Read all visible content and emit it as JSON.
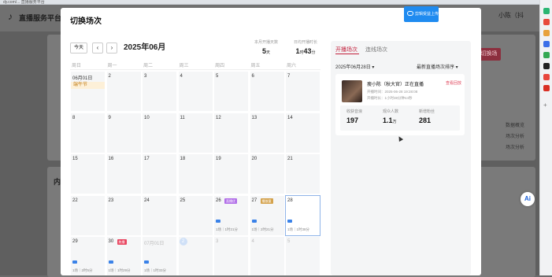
{
  "browser": {
    "url": "dy.com/... 直播服务平台"
  },
  "background": {
    "logo": "♪",
    "title": "直播服务平台 · 主",
    "user": "小陈（抖",
    "red_button": "切换场",
    "inner_label": "内",
    "side_links": [
      "数据概览",
      "场次分析",
      "场次分析"
    ]
  },
  "modal": {
    "title": "切换场次",
    "upload_button": "剪辑受益上传",
    "today_button": "今天",
    "prev": "‹",
    "next": "›",
    "month": "2025年06月",
    "stats": [
      {
        "label": "本月开播天数",
        "value": "5",
        "unit": "天"
      },
      {
        "label": "日均开播时长",
        "value": "1",
        "unit": "时",
        "value2": "43",
        "unit2": "分"
      }
    ],
    "weekdays": [
      "周日",
      "周一",
      "周二",
      "周三",
      "周四",
      "周五",
      "周六"
    ],
    "days": [
      {
        "d": "06月01日",
        "holiday": "端午节"
      },
      {
        "d": "2"
      },
      {
        "d": "3"
      },
      {
        "d": "4"
      },
      {
        "d": "5"
      },
      {
        "d": "6"
      },
      {
        "d": "7"
      },
      {
        "d": "8"
      },
      {
        "d": "9"
      },
      {
        "d": "10"
      },
      {
        "d": "11"
      },
      {
        "d": "12"
      },
      {
        "d": "13"
      },
      {
        "d": "14"
      },
      {
        "d": "15"
      },
      {
        "d": "16"
      },
      {
        "d": "17"
      },
      {
        "d": "18"
      },
      {
        "d": "19"
      },
      {
        "d": "20"
      },
      {
        "d": "21"
      },
      {
        "d": "22"
      },
      {
        "d": "23"
      },
      {
        "d": "24"
      },
      {
        "d": "25"
      },
      {
        "d": "26",
        "tag": "直播优",
        "tag_color": "purple",
        "meta": "1场｜1时21分"
      },
      {
        "d": "27",
        "tag": "播放量",
        "tag_color": "orange",
        "meta": "1场｜2时21分"
      },
      {
        "d": "28",
        "meta": "1场｜1时38分",
        "selected": true
      },
      {
        "d": "29",
        "meta": "1场｜2时5分"
      },
      {
        "d": "30",
        "tag": "热播",
        "tag_color": "red",
        "meta": "1场｜1时29分"
      },
      {
        "d": "07月01日",
        "meta": "1场｜1时33分",
        "muted": true
      },
      {
        "d": "2",
        "today": true,
        "muted": true
      },
      {
        "d": "3",
        "muted": true
      },
      {
        "d": "4",
        "muted": true
      },
      {
        "d": "5",
        "muted": true
      }
    ],
    "panel": {
      "tab_active": "开播场次",
      "tab_inactive": "连线场次",
      "date_select": "2025年06月28日 ▾",
      "sort_select": "最新直播场次排序 ▾",
      "session": {
        "title": "瘦小陈（秋大官）正在直播",
        "link": "查看回放",
        "start": "开播时间：2025-06-28 19:28:08",
        "duration": "开播时长：1小时38分钟44秒",
        "metrics": [
          {
            "label": "收获音浪",
            "value": "197",
            "unit": ""
          },
          {
            "label": "观众人数",
            "value": "1.1",
            "unit": "万"
          },
          {
            "label": "新增粉丝",
            "value": "281",
            "unit": ""
          }
        ]
      }
    }
  }
}
